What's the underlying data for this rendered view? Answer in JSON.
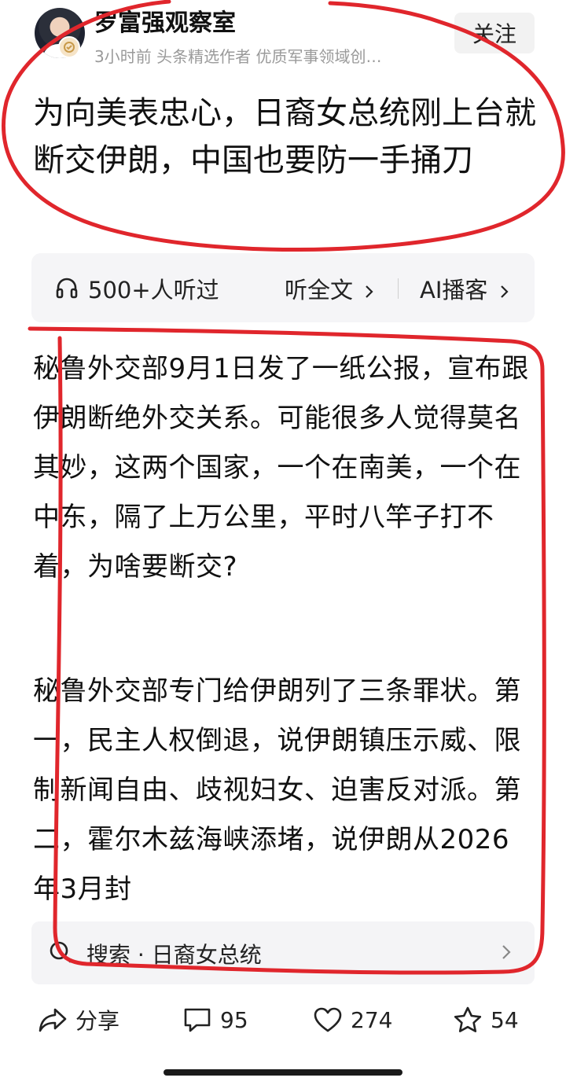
{
  "author": {
    "name": "罗富强观察室",
    "meta": "3小时前  头条精选作者 优质军事领域创…",
    "follow_label": "关注"
  },
  "article": {
    "title": "为向美表忠心，日裔女总统刚上台就断交伊朗，中国也要防一手捅刀",
    "paragraphs": [
      "秘鲁外交部9月1日发了一纸公报，宣布跟伊朗断绝外交关系。可能很多人觉得莫名其妙，这两个国家，一个在南美，一个在中东，隔了上万公里，平时八竿子打不着，为啥要断交?",
      "秘鲁外交部专门给伊朗列了三条罪状。第一，民主人权倒退，说伊朗镇压示威、限制新闻自由、歧视妇女、迫害反对派。第二，霍尔木兹海峡添堵，说伊朗从2026年3月封"
    ]
  },
  "listen_bar": {
    "count": "500+人听过",
    "full_text_label": "听全文",
    "ai_podcast_label": "AI播客"
  },
  "search": {
    "text": "搜索 · 日裔女总统"
  },
  "actions": {
    "share_label": "分享",
    "comment_count": "95",
    "like_count": "274",
    "favorite_count": "54"
  },
  "colors": {
    "annotation_red": "#e0262c",
    "meta_gray": "#9a9a9a",
    "panel_bg": "#f5f5f7"
  },
  "icons": [
    "headphones-icon",
    "chevron-right-icon",
    "search-icon",
    "share-icon",
    "comment-icon",
    "heart-icon",
    "star-icon",
    "verified-badge-icon"
  ]
}
